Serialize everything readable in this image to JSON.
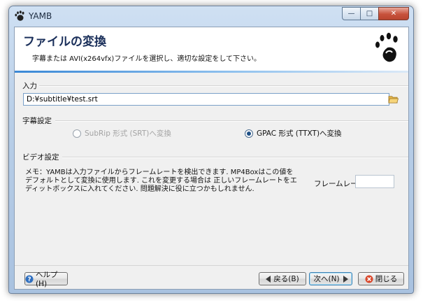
{
  "window": {
    "title": "YAMB",
    "minimize_glyph": "—",
    "maximize_glyph": "□",
    "close_glyph": "✕"
  },
  "header": {
    "title": "ファイルの変換",
    "subtitle": "字幕または AVI(x264vfx)ファイルを選択し、適切な設定をして下さい。",
    "logo_icon": "gnome-foot-icon"
  },
  "input_section": {
    "label": "入力",
    "path_value": "D:¥subtitle¥test.srt",
    "browse_icon": "folder-open-icon"
  },
  "subtitle_section": {
    "label": "字幕設定",
    "options": [
      {
        "label": "SubRip 形式 (SRT)へ変換",
        "selected": false,
        "enabled": false
      },
      {
        "label": "GPAC 形式 (TTXT)へ変換",
        "selected": true,
        "enabled": true
      }
    ]
  },
  "video_section": {
    "label": "ビデオ設定",
    "memo": "メモ：YAMBは入力ファイルからフレームレートを検出できます. MP4Boxはこの値をデフォルトとして変換に使用します. これを変更する場合は 正しいフレームレートをエディットボックスに入れてください. 問題解決に役に立つかもしれません.",
    "framerate_label": "フレームレート:",
    "framerate_value": ""
  },
  "footer": {
    "help_label": "ヘルプ(H)",
    "back_label": "戻る(B)",
    "next_label": "次へ(N)",
    "close_label": "閉じる"
  },
  "colors": {
    "accent": "#3a88d6",
    "header_title": "#1a2f5a",
    "frame": "#b9cfe8"
  }
}
